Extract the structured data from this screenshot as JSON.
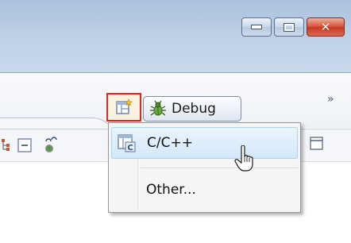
{
  "window": {
    "caption_buttons": [
      {
        "name": "minimize",
        "icon": "minimize-icon"
      },
      {
        "name": "maximize",
        "icon": "maximize-icon"
      },
      {
        "name": "close",
        "icon": "close-icon",
        "glyph": "✕"
      }
    ]
  },
  "toolbar": {
    "open_perspective": {
      "icon": "open-perspective-icon"
    },
    "debug_perspective": {
      "label": "Debug",
      "icon": "bug-icon"
    },
    "overflow": {
      "glyph": "»"
    }
  },
  "menu": {
    "items": [
      {
        "label": "C/C++",
        "icon": "cpp-perspective-icon",
        "hovered": true
      },
      {
        "label": "Other...",
        "icon": "",
        "hovered": false
      }
    ]
  },
  "colors": {
    "highlight_border": "#e0261d",
    "menu_hover": "#d4e8fa",
    "title_bar": "#bccfe5"
  }
}
